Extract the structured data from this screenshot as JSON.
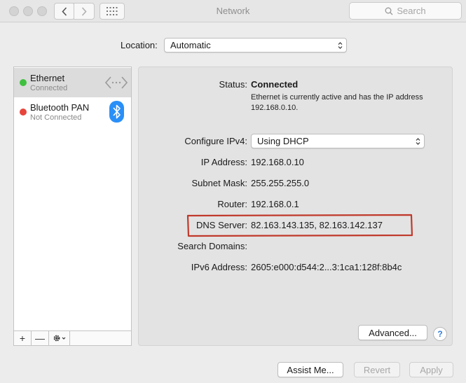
{
  "window": {
    "title": "Network",
    "search_placeholder": "Search"
  },
  "location": {
    "label": "Location:",
    "value": "Automatic"
  },
  "services": [
    {
      "name": "Ethernet",
      "status": "Connected",
      "status_color": "#3fc13f",
      "icon": "ethernet-arrows-icon",
      "selected": true
    },
    {
      "name": "Bluetooth PAN",
      "status": "Not Connected",
      "status_color": "#e8453c",
      "icon": "bluetooth-icon",
      "selected": false
    }
  ],
  "sidebar_toolbar": {
    "add": "+",
    "remove": "—"
  },
  "details": {
    "status_label": "Status:",
    "status_value": "Connected",
    "status_description": "Ethernet is currently active and has the IP address 192.168.0.10.",
    "configure_label": "Configure IPv4:",
    "configure_value": "Using DHCP",
    "ip_label": "IP Address:",
    "ip_value": "192.168.0.10",
    "subnet_label": "Subnet Mask:",
    "subnet_value": "255.255.255.0",
    "router_label": "Router:",
    "router_value": "192.168.0.1",
    "dns_label": "DNS Server:",
    "dns_value": "82.163.143.135, 82.163.142.137",
    "search_domains_label": "Search Domains:",
    "search_domains_value": "",
    "ipv6_label": "IPv6 Address:",
    "ipv6_value": "2605:e000:d544:2...3:1ca1:128f:8b4c"
  },
  "buttons": {
    "advanced": "Advanced...",
    "help": "?",
    "assist": "Assist Me...",
    "revert": "Revert",
    "apply": "Apply"
  },
  "colors": {
    "highlight": "#c0392b",
    "bluetooth": "#2a8ff7",
    "help": "#2f7de1"
  }
}
